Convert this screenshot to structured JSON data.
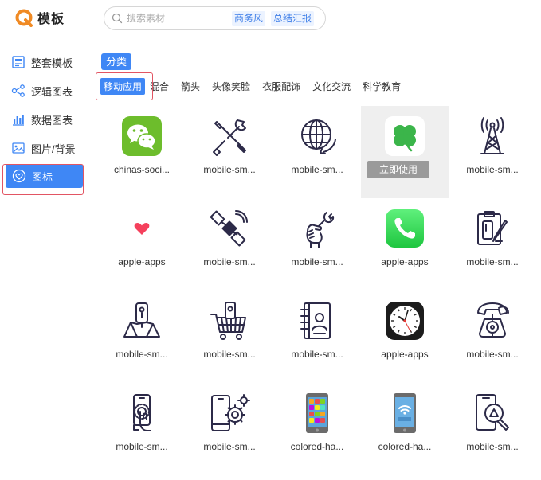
{
  "header": {
    "logo_text": "模板",
    "search_placeholder": "搜索素材",
    "tags": [
      "商务风",
      "总结汇报"
    ]
  },
  "sidebar": {
    "items": [
      {
        "label": "整套模板",
        "icon": "template-icon",
        "active": false
      },
      {
        "label": "逻辑图表",
        "icon": "logic-diagram-icon",
        "active": false
      },
      {
        "label": "数据图表",
        "icon": "bar-chart-icon",
        "active": false
      },
      {
        "label": "图片/背景",
        "icon": "image-icon",
        "active": false
      },
      {
        "label": "图标",
        "icon": "heart-icon",
        "active": true
      }
    ]
  },
  "category": {
    "title": "分类",
    "tabs": [
      "移动应用",
      "混合",
      "箭头",
      "头像笑脸",
      "衣服配饰",
      "文化交流",
      "科学教育"
    ],
    "active_tab": "移动应用"
  },
  "grid": {
    "use_button_label": "立即使用",
    "items": [
      {
        "label": "chinas-soci...",
        "icon": "wechat-icon"
      },
      {
        "label": "mobile-sm...",
        "icon": "tools-icon"
      },
      {
        "label": "mobile-sm...",
        "icon": "globe-icon"
      },
      {
        "label": "",
        "icon": "clover-app-icon",
        "hover": true
      },
      {
        "label": "mobile-sm...",
        "icon": "signal-tower-icon"
      },
      {
        "label": "apple-apps",
        "icon": "heart-app-icon"
      },
      {
        "label": "mobile-sm...",
        "icon": "satellite-icon"
      },
      {
        "label": "mobile-sm...",
        "icon": "wrench-hand-icon"
      },
      {
        "label": "apple-apps",
        "icon": "phone-app-icon"
      },
      {
        "label": "mobile-sm...",
        "icon": "clipboard-phone-icon"
      },
      {
        "label": "mobile-sm...",
        "icon": "map-pin-phone-icon"
      },
      {
        "label": "mobile-sm...",
        "icon": "shopping-cart-phone-icon"
      },
      {
        "label": "mobile-sm...",
        "icon": "contact-book-icon"
      },
      {
        "label": "apple-apps",
        "icon": "clock-app-icon"
      },
      {
        "label": "mobile-sm...",
        "icon": "rotary-phone-icon"
      },
      {
        "label": "mobile-sm...",
        "icon": "touch-phone-icon"
      },
      {
        "label": "mobile-sm...",
        "icon": "phone-settings-icon"
      },
      {
        "label": "colored-ha...",
        "icon": "colored-phone-apps-icon"
      },
      {
        "label": "colored-ha...",
        "icon": "colored-phone-wifi-icon"
      },
      {
        "label": "mobile-sm...",
        "icon": "phone-search-icon"
      }
    ]
  },
  "colors": {
    "accent": "#3f87f5",
    "highlight_outline": "#e25563",
    "tag_bg": "#ecf3ff",
    "tag_text": "#3f7fe8",
    "icon_stroke": "#2c2a48"
  }
}
